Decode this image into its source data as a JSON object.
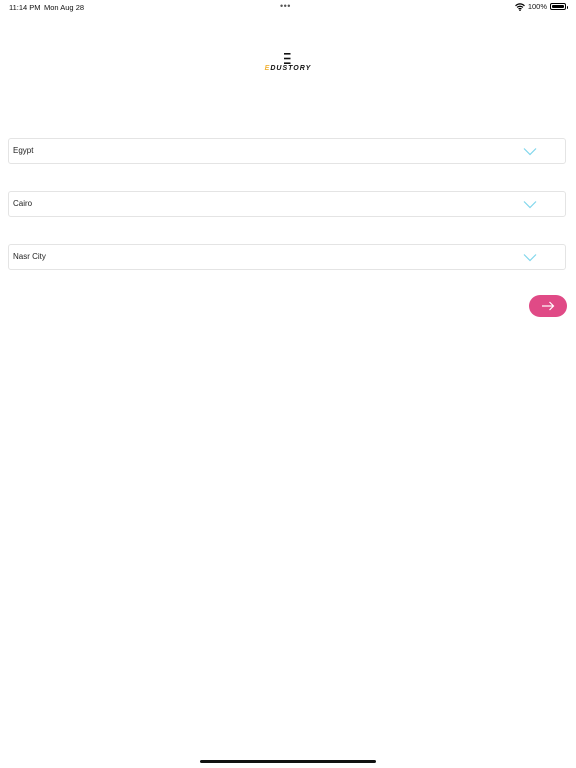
{
  "status_bar": {
    "time": "11:14 PM",
    "date": "Mon Aug 28",
    "dots": "•••",
    "battery_text": "100%",
    "battery_level": 1.0,
    "icons": [
      "wifi-icon",
      "battery-icon"
    ]
  },
  "logo": {
    "text_accent": "E",
    "text_rest": "DUSTORY",
    "icon": "edustory-logo-icon",
    "accent_color": "#f2b43a"
  },
  "form": {
    "country": {
      "value": "Egypt",
      "icon": "chevron-down-icon"
    },
    "city": {
      "value": "Cairo",
      "icon": "chevron-down-icon"
    },
    "district": {
      "value": "Nasr City",
      "icon": "chevron-down-icon"
    }
  },
  "actions": {
    "next": {
      "icon": "arrow-right-icon",
      "color": "#e04a86"
    }
  },
  "colors": {
    "chevron": "#7fd6ec",
    "field_border": "#e4e4e4"
  }
}
